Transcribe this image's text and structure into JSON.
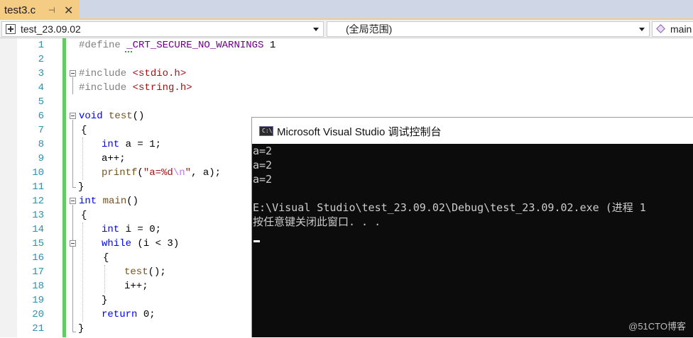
{
  "tab": {
    "title": "test3.c",
    "pin_icon": "pin-icon",
    "close_symbol": "✕"
  },
  "navbar": {
    "project": "test_23.09.02",
    "scope": "(全局范围)",
    "member": "main"
  },
  "editor": {
    "line_numbers": [
      "1",
      "2",
      "3",
      "4",
      "5",
      "6",
      "7",
      "8",
      "9",
      "10",
      "11",
      "12",
      "13",
      "14",
      "15",
      "16",
      "17",
      "18",
      "19",
      "20",
      "21"
    ],
    "code": {
      "l1_pp": "#define ",
      "l1_macro": "_CRT_SECURE_NO_WARNINGS",
      "l1_val": " 1",
      "l3_pp": "#include ",
      "l3_hdr": "<stdio.h>",
      "l4_pp": "#include ",
      "l4_hdr": "<string.h>",
      "l6_kw": "void",
      "l6_fn": " test",
      "l6_rest": "()",
      "l7": "{",
      "l8_kw": "int",
      "l8_rest": " a = 1;",
      "l9": "a++;",
      "l10_fn": "printf",
      "l10_p1": "(",
      "l10_s1": "\"a=%d",
      "l10_esc": "\\n",
      "l10_s2": "\"",
      "l10_p2": ", a);",
      "l11": "}",
      "l12_kw": "int",
      "l12_fn": " main",
      "l12_rest": "()",
      "l13": "{",
      "l14_kw": "int",
      "l14_rest": " i = 0;",
      "l15_kw": "while",
      "l15_rest": " (i < 3)",
      "l16": "{",
      "l17_fn": "test",
      "l17_rest": "();",
      "l18": "i++;",
      "l19": "}",
      "l20_kw": "return",
      "l20_rest": " 0;",
      "l21": "}"
    }
  },
  "console": {
    "title": "Microsoft Visual Studio 调试控制台",
    "icon_text": "C:\\",
    "lines": [
      "a=2",
      "a=2",
      "a=2",
      "",
      "E:\\Visual Studio\\test_23.09.02\\Debug\\test_23.09.02.exe (进程 1",
      "按任意键关闭此窗口. . ."
    ]
  },
  "watermark": "@51CTO博客",
  "colors": {
    "tab_active": "#f5cc84",
    "keyword": "#0000ff",
    "preprocessor": "#808080",
    "string": "#a31515",
    "macro": "#6f008a",
    "line_number": "#2b91af",
    "change_bar": "#5fcd5f",
    "console_bg": "#0c0c0c"
  }
}
